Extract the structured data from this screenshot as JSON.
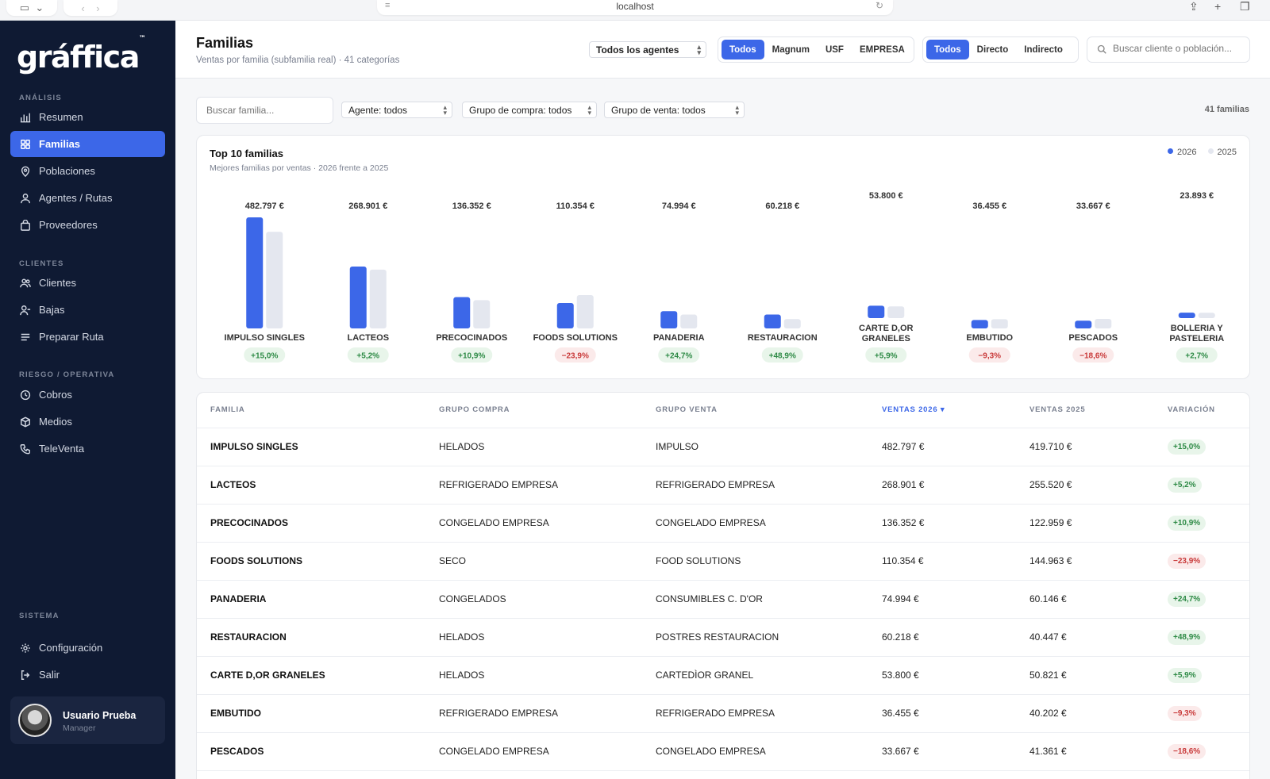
{
  "browser": {
    "url": "localhost"
  },
  "sidebar": {
    "logo": "gráffica",
    "logo_tm": "™",
    "sections": {
      "analisis": "ANÁLISIS",
      "clientes": "CLIENTES",
      "riesgo": "RIESGO / OPERATIVA",
      "sistema": "SISTEMA"
    },
    "items": {
      "resumen": "Resumen",
      "familias": "Familias",
      "poblaciones": "Poblaciones",
      "agentes": "Agentes / Rutas",
      "proveedores": "Proveedores",
      "clientes": "Clientes",
      "bajas": "Bajas",
      "preparar": "Preparar Ruta",
      "cobros": "Cobros",
      "medios": "Medios",
      "televenta": "TeleVenta",
      "config": "Configuración",
      "salir": "Salir"
    },
    "user": {
      "name": "Usuario Prueba",
      "role": "Manager"
    }
  },
  "header": {
    "title": "Familias",
    "subtitle": "Ventas por familia (subfamilia real) · 41 categorías",
    "agent_select": "Todos los agentes",
    "seg1": [
      "Todos",
      "Magnum",
      "USF",
      "EMPRESA"
    ],
    "seg2": [
      "Todos",
      "Directo",
      "Indirecto"
    ],
    "search_placeholder": "Buscar cliente o población..."
  },
  "filters": {
    "search_placeholder": "Buscar familia...",
    "agente": "Agente: todos",
    "grupo_compra": "Grupo de compra: todos",
    "grupo_venta": "Grupo de venta: todos",
    "count": "41 familias"
  },
  "chart_title": "Top 10 familias",
  "chart_subtitle": "Mejores familias por ventas · 2026 frente a 2025",
  "colors": {
    "accent": "#3c67e8",
    "prev": "#e4e7ef",
    "pos": "#2d8a45",
    "neg": "#c93a3a"
  },
  "chart_data": {
    "type": "bar",
    "legend_position": "top-right",
    "categories": [
      "IMPULSO SINGLES",
      "LACTEOS",
      "PRECOCINADOS",
      "FOODS SOLUTIONS",
      "PANADERIA",
      "RESTAURACION",
      "CARTE D,OR GRANELES",
      "EMBUTIDO",
      "PESCADOS",
      "BOLLERIA Y PASTELERIA"
    ],
    "series": [
      {
        "name": "2026",
        "values": [
          482797,
          268901,
          136352,
          110354,
          74994,
          60218,
          53800,
          36455,
          33667,
          23893
        ]
      },
      {
        "name": "2025",
        "values": [
          419710,
          255520,
          122959,
          144963,
          60146,
          40447,
          50821,
          40202,
          41361,
          23264
        ]
      }
    ],
    "value_labels": [
      "482.797 €",
      "268.901 €",
      "136.352 €",
      "110.354 €",
      "74.994 €",
      "60.218 €",
      "53.800 €",
      "36.455 €",
      "33.667 €",
      "23.893 €"
    ],
    "variations": [
      "+15,0%",
      "+5,2%",
      "+10,9%",
      "−23,9%",
      "+24,7%",
      "+48,9%",
      "+5,9%",
      "−9,3%",
      "−18,6%",
      "+2,7%"
    ]
  },
  "table": {
    "columns": [
      "FAMILIA",
      "GRUPO COMPRA",
      "GRUPO VENTA",
      "VENTAS 2026 ▾",
      "VENTAS 2025",
      "VARIACIÓN"
    ],
    "rows": [
      [
        "IMPULSO SINGLES",
        "HELADOS",
        "IMPULSO",
        "482.797 €",
        "419.710 €",
        "+15,0%"
      ],
      [
        "LACTEOS",
        "REFRIGERADO EMPRESA",
        "REFRIGERADO EMPRESA",
        "268.901 €",
        "255.520 €",
        "+5,2%"
      ],
      [
        "PRECOCINADOS",
        "CONGELADO EMPRESA",
        "CONGELADO EMPRESA",
        "136.352 €",
        "122.959 €",
        "+10,9%"
      ],
      [
        "FOODS SOLUTIONS",
        "SECO",
        "FOOD SOLUTIONS",
        "110.354 €",
        "144.963 €",
        "−23,9%"
      ],
      [
        "PANADERIA",
        "CONGELADOS",
        "CONSUMIBLES C. D'OR",
        "74.994 €",
        "60.146 €",
        "+24,7%"
      ],
      [
        "RESTAURACION",
        "HELADOS",
        "POSTRES RESTAURACION",
        "60.218 €",
        "40.447 €",
        "+48,9%"
      ],
      [
        "CARTE D,OR GRANELES",
        "HELADOS",
        "CARTEDÌOR GRANEL",
        "53.800 €",
        "50.821 €",
        "+5,9%"
      ],
      [
        "EMBUTIDO",
        "REFRIGERADO EMPRESA",
        "REFRIGERADO EMPRESA",
        "36.455 €",
        "40.202 €",
        "−9,3%"
      ],
      [
        "PESCADOS",
        "CONGELADO EMPRESA",
        "CONGELADO EMPRESA",
        "33.667 €",
        "41.361 €",
        "−18,6%"
      ]
    ]
  }
}
